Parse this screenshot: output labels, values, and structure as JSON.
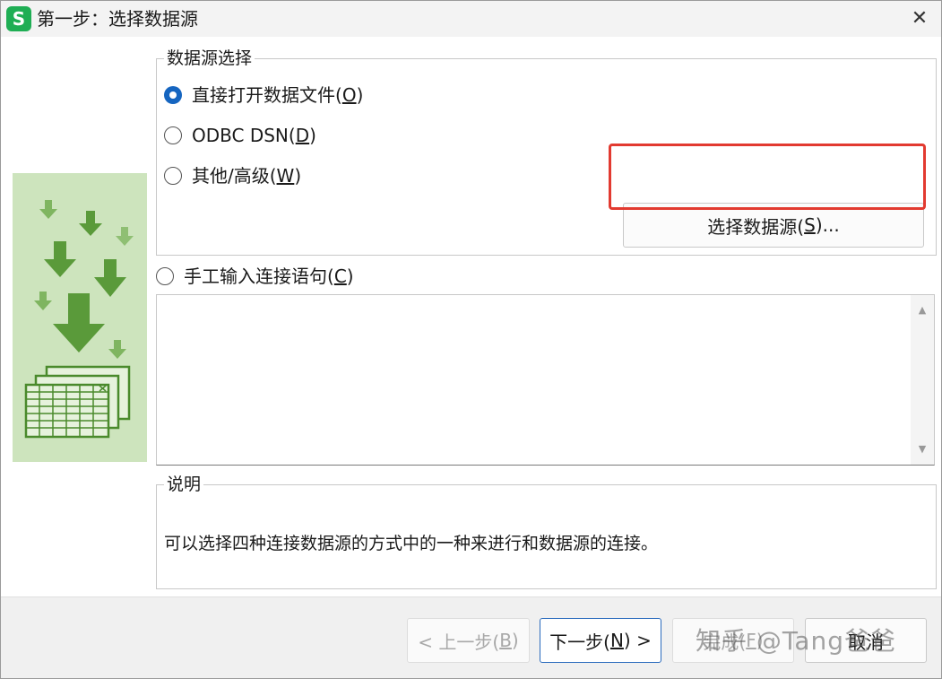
{
  "window": {
    "app_icon_letter": "S",
    "title": "第一步：选择数据源",
    "close_glyph": "✕"
  },
  "datasource_group": {
    "legend": "数据源选择",
    "options": [
      {
        "label": "直接打开数据文件(",
        "mnemonic": "O",
        "suffix": ")",
        "selected": true
      },
      {
        "label": "ODBC DSN(",
        "mnemonic": "D",
        "suffix": ")",
        "selected": false
      },
      {
        "label": "其他/高级(",
        "mnemonic": "W",
        "suffix": ")",
        "selected": false
      }
    ],
    "select_button": {
      "label": "选择数据源(",
      "mnemonic": "S",
      "suffix": ")..."
    }
  },
  "manual": {
    "label": "手工输入连接语句(",
    "mnemonic": "C",
    "suffix": ")",
    "selected": false,
    "value": ""
  },
  "description": {
    "legend": "说明",
    "text": "可以选择四种连接数据源的方式中的一种来进行和数据源的连接。"
  },
  "footer": {
    "back": {
      "label": "< 上一步(",
      "mnemonic": "B",
      "suffix": ")"
    },
    "next": {
      "label": "下一步(",
      "mnemonic": "N",
      "suffix": ") >"
    },
    "finish": {
      "label": "完成(",
      "mnemonic": "F",
      "suffix": ")"
    },
    "cancel": {
      "label": "取消"
    }
  },
  "watermark": "知乎 @Tang爸爸",
  "colors": {
    "accent": "#1565c0",
    "highlight": "#e23a30",
    "illustration_bg": "#cde4bd",
    "arrow_green": "#5a9a3a",
    "app_icon": "#1fae54"
  },
  "icons": [
    "spreadsheet-app-icon",
    "close-icon",
    "download-arrows-illustration",
    "scroll-up-icon",
    "scroll-down-icon"
  ]
}
